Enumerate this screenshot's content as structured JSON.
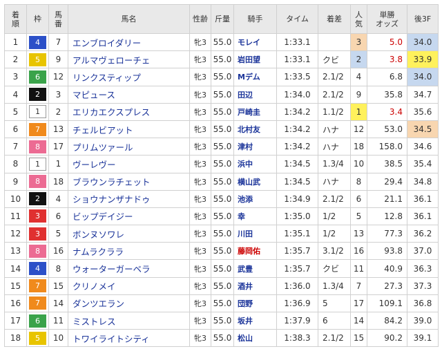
{
  "headers": [
    {
      "key": "rank",
      "label": "着\n順"
    },
    {
      "key": "waku",
      "label": "枠"
    },
    {
      "key": "uma",
      "label": "馬\n番"
    },
    {
      "key": "name",
      "label": "馬名"
    },
    {
      "key": "sex",
      "label": "性齢"
    },
    {
      "key": "kin",
      "label": "斤量"
    },
    {
      "key": "jockey",
      "label": "騎手"
    },
    {
      "key": "time",
      "label": "タイム"
    },
    {
      "key": "margin",
      "label": "着差"
    },
    {
      "key": "pop",
      "label": "人\n気"
    },
    {
      "key": "odds",
      "label": "単勝\nオッズ"
    },
    {
      "key": "last",
      "label": "後3F"
    }
  ],
  "waku_colors": {
    "1": {
      "bg": "#ffffff",
      "fg": "#333333",
      "border": "#999999"
    },
    "2": {
      "bg": "#111111",
      "fg": "#ffffff",
      "border": "#111111"
    },
    "3": {
      "bg": "#e03030",
      "fg": "#ffffff",
      "border": "#e03030"
    },
    "4": {
      "bg": "#2c50c8",
      "fg": "#ffffff",
      "border": "#2c50c8"
    },
    "5": {
      "bg": "#e8c400",
      "fg": "#ffffff",
      "border": "#e8c400"
    },
    "6": {
      "bg": "#3aa34a",
      "fg": "#ffffff",
      "border": "#3aa34a"
    },
    "7": {
      "bg": "#f08a1c",
      "fg": "#ffffff",
      "border": "#f08a1c"
    },
    "8": {
      "bg": "#ec6b93",
      "fg": "#ffffff",
      "border": "#ec6b93"
    }
  },
  "rows": [
    {
      "rank": "1",
      "waku": "4",
      "uma": "7",
      "name": "エンブロイダリー",
      "sex": "牝3",
      "kin": "55.0",
      "jockey": "モレイ",
      "jockey_red": false,
      "time": "1:33.1",
      "margin": "",
      "pop": "3",
      "odds": "5.0",
      "odds_red": true,
      "last": "34.0",
      "last_rank": 2
    },
    {
      "rank": "2",
      "waku": "5",
      "uma": "9",
      "name": "アルマヴェローチェ",
      "sex": "牝3",
      "kin": "55.0",
      "jockey": "岩田望",
      "jockey_red": false,
      "time": "1:33.1",
      "margin": "クビ",
      "pop": "2",
      "odds": "3.8",
      "odds_red": true,
      "last": "33.9",
      "last_rank": 1
    },
    {
      "rank": "3",
      "waku": "6",
      "uma": "12",
      "name": "リンクスティップ",
      "sex": "牝3",
      "kin": "55.0",
      "jockey": "Mデム",
      "jockey_red": false,
      "time": "1:33.5",
      "margin": "2.1/2",
      "pop": "4",
      "odds": "6.8",
      "odds_red": false,
      "last": "34.0",
      "last_rank": 2
    },
    {
      "rank": "4",
      "waku": "2",
      "uma": "3",
      "name": "マピュース",
      "sex": "牝3",
      "kin": "55.0",
      "jockey": "田辺",
      "jockey_red": false,
      "time": "1:34.0",
      "margin": "2.1/2",
      "pop": "9",
      "odds": "35.8",
      "odds_red": false,
      "last": "34.7",
      "last_rank": 0
    },
    {
      "rank": "5",
      "waku": "1",
      "uma": "2",
      "name": "エリカエクスプレス",
      "sex": "牝3",
      "kin": "55.0",
      "jockey": "戸崎圭",
      "jockey_red": false,
      "time": "1:34.2",
      "margin": "1.1/2",
      "pop": "1",
      "odds": "3.4",
      "odds_red": true,
      "last": "35.6",
      "last_rank": 0
    },
    {
      "rank": "6",
      "waku": "7",
      "uma": "13",
      "name": "チェルビアット",
      "sex": "牝3",
      "kin": "55.0",
      "jockey": "北村友",
      "jockey_red": false,
      "time": "1:34.2",
      "margin": "ハナ",
      "pop": "12",
      "odds": "53.0",
      "odds_red": false,
      "last": "34.5",
      "last_rank": 3
    },
    {
      "rank": "7",
      "waku": "8",
      "uma": "17",
      "name": "プリムツァール",
      "sex": "牝3",
      "kin": "55.0",
      "jockey": "津村",
      "jockey_red": false,
      "time": "1:34.2",
      "margin": "ハナ",
      "pop": "18",
      "odds": "158.0",
      "odds_red": false,
      "last": "34.6",
      "last_rank": 0
    },
    {
      "rank": "8",
      "waku": "1",
      "uma": "1",
      "name": "ヴーレヴー",
      "sex": "牝3",
      "kin": "55.0",
      "jockey": "浜中",
      "jockey_red": false,
      "time": "1:34.5",
      "margin": "1.3/4",
      "pop": "10",
      "odds": "38.5",
      "odds_red": false,
      "last": "35.4",
      "last_rank": 0
    },
    {
      "rank": "9",
      "waku": "8",
      "uma": "18",
      "name": "ブラウンラチェット",
      "sex": "牝3",
      "kin": "55.0",
      "jockey": "横山武",
      "jockey_red": false,
      "time": "1:34.5",
      "margin": "ハナ",
      "pop": "8",
      "odds": "29.4",
      "odds_red": false,
      "last": "34.8",
      "last_rank": 0
    },
    {
      "rank": "10",
      "waku": "2",
      "uma": "4",
      "name": "ショウナンザナドゥ",
      "sex": "牝3",
      "kin": "55.0",
      "jockey": "池添",
      "jockey_red": false,
      "time": "1:34.9",
      "margin": "2.1/2",
      "pop": "6",
      "odds": "21.1",
      "odds_red": false,
      "last": "36.1",
      "last_rank": 0
    },
    {
      "rank": "11",
      "waku": "3",
      "uma": "6",
      "name": "ビップデイジー",
      "sex": "牝3",
      "kin": "55.0",
      "jockey": "幸",
      "jockey_red": false,
      "time": "1:35.0",
      "margin": "1/2",
      "pop": "5",
      "odds": "12.8",
      "odds_red": false,
      "last": "36.1",
      "last_rank": 0
    },
    {
      "rank": "12",
      "waku": "3",
      "uma": "5",
      "name": "ボンヌソワレ",
      "sex": "牝3",
      "kin": "55.0",
      "jockey": "川田",
      "jockey_red": false,
      "time": "1:35.1",
      "margin": "1/2",
      "pop": "13",
      "odds": "77.3",
      "odds_red": false,
      "last": "36.2",
      "last_rank": 0
    },
    {
      "rank": "13",
      "waku": "8",
      "uma": "16",
      "name": "ナムラクララ",
      "sex": "牝3",
      "kin": "55.0",
      "jockey": "藤岡佑",
      "jockey_red": true,
      "time": "1:35.7",
      "margin": "3.1/2",
      "pop": "16",
      "odds": "93.8",
      "odds_red": false,
      "last": "37.0",
      "last_rank": 0
    },
    {
      "rank": "14",
      "waku": "4",
      "uma": "8",
      "name": "ウォーターガーベラ",
      "sex": "牝3",
      "kin": "55.0",
      "jockey": "武豊",
      "jockey_red": false,
      "time": "1:35.7",
      "margin": "クビ",
      "pop": "11",
      "odds": "40.9",
      "odds_red": false,
      "last": "36.3",
      "last_rank": 0
    },
    {
      "rank": "15",
      "waku": "7",
      "uma": "15",
      "name": "クリノメイ",
      "sex": "牝3",
      "kin": "55.0",
      "jockey": "酒井",
      "jockey_red": false,
      "time": "1:36.0",
      "margin": "1.3/4",
      "pop": "7",
      "odds": "27.3",
      "odds_red": false,
      "last": "37.3",
      "last_rank": 0
    },
    {
      "rank": "16",
      "waku": "7",
      "uma": "14",
      "name": "ダンツエラン",
      "sex": "牝3",
      "kin": "55.0",
      "jockey": "団野",
      "jockey_red": false,
      "time": "1:36.9",
      "margin": "5",
      "pop": "17",
      "odds": "109.1",
      "odds_red": false,
      "last": "36.8",
      "last_rank": 0
    },
    {
      "rank": "17",
      "waku": "6",
      "uma": "11",
      "name": "ミストレス",
      "sex": "牝3",
      "kin": "55.0",
      "jockey": "坂井",
      "jockey_red": false,
      "time": "1:37.9",
      "margin": "6",
      "pop": "14",
      "odds": "84.2",
      "odds_red": false,
      "last": "39.0",
      "last_rank": 0
    },
    {
      "rank": "18",
      "waku": "5",
      "uma": "10",
      "name": "トワイライトシティ",
      "sex": "牝3",
      "kin": "55.0",
      "jockey": "松山",
      "jockey_red": false,
      "time": "1:38.3",
      "margin": "2.1/2",
      "pop": "15",
      "odds": "90.2",
      "odds_red": false,
      "last": "39.1",
      "last_rank": 0
    }
  ]
}
